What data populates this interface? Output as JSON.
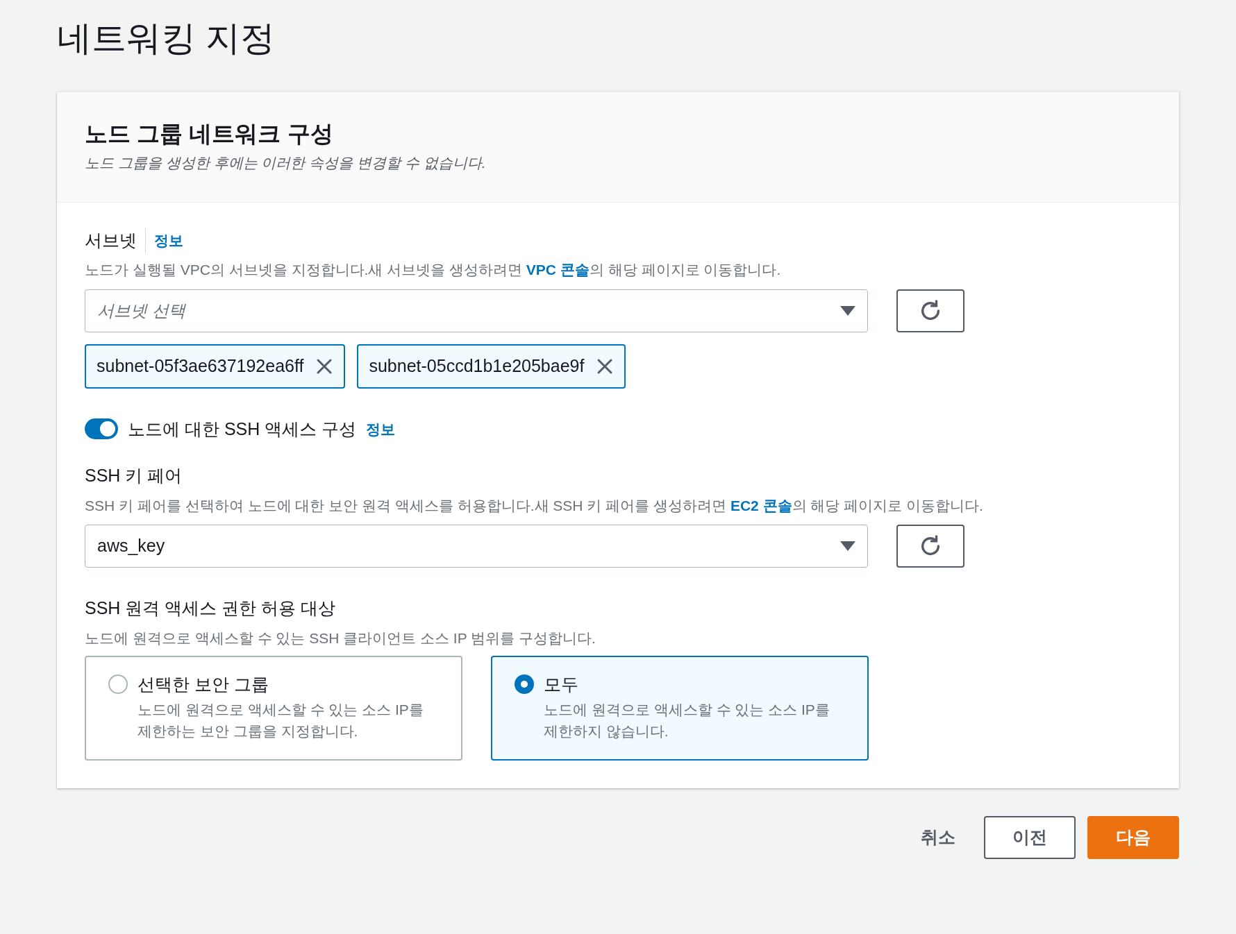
{
  "page_title": "네트워킹 지정",
  "panel": {
    "title": "노드 그룹 네트워크 구성",
    "description": "노드 그룹을 생성한 후에는 이러한 속성을 변경할 수 없습니다."
  },
  "subnet": {
    "label": "서브넷",
    "info_link": "정보",
    "description_before": "노드가 실행될 VPC의 서브넷을 지정합니다.새 서브넷을 생성하려면 ",
    "description_link": "VPC 콘솔",
    "description_after": "의 해당 페이지로 이동합니다.",
    "select": {
      "placeholder": "서브넷 선택"
    },
    "tokens": [
      {
        "label": "subnet-05f3ae637192ea6ff"
      },
      {
        "label": "subnet-05ccd1b1e205bae9f"
      }
    ]
  },
  "ssh_toggle": {
    "label": "노드에 대한 SSH 액세스 구성",
    "info_link": "정보",
    "on": true
  },
  "key_pair": {
    "label": "SSH 키 페어",
    "description_before": "SSH 키 페어를 선택하여 노드에 대한 보안 원격 액세스를 허용합니다.새 SSH 키 페어를 생성하려면 ",
    "description_link": "EC2 콘솔",
    "description_after": "의 해당 페이지로 이동합니다.",
    "select": {
      "value": "aws_key"
    }
  },
  "access": {
    "label": "SSH 원격 액세스 권한 허용 대상",
    "description": "노드에 원격으로 액세스할 수 있는 SSH 클라이언트 소스 IP 범위를 구성합니다.",
    "options": [
      {
        "title": "선택한 보안 그룹",
        "description": "노드에 원격으로 액세스할 수 있는 소스 IP를 제한하는 보안 그룹을 지정합니다.",
        "selected": false
      },
      {
        "title": "모두",
        "description": "노드에 원격으로 액세스할 수 있는 소스 IP를 제한하지 않습니다.",
        "selected": true
      }
    ]
  },
  "buttons": [
    {
      "label": "취소",
      "kind": "link"
    },
    {
      "label": "이전",
      "kind": "secondary"
    },
    {
      "label": "다음",
      "kind": "primary"
    }
  ]
}
